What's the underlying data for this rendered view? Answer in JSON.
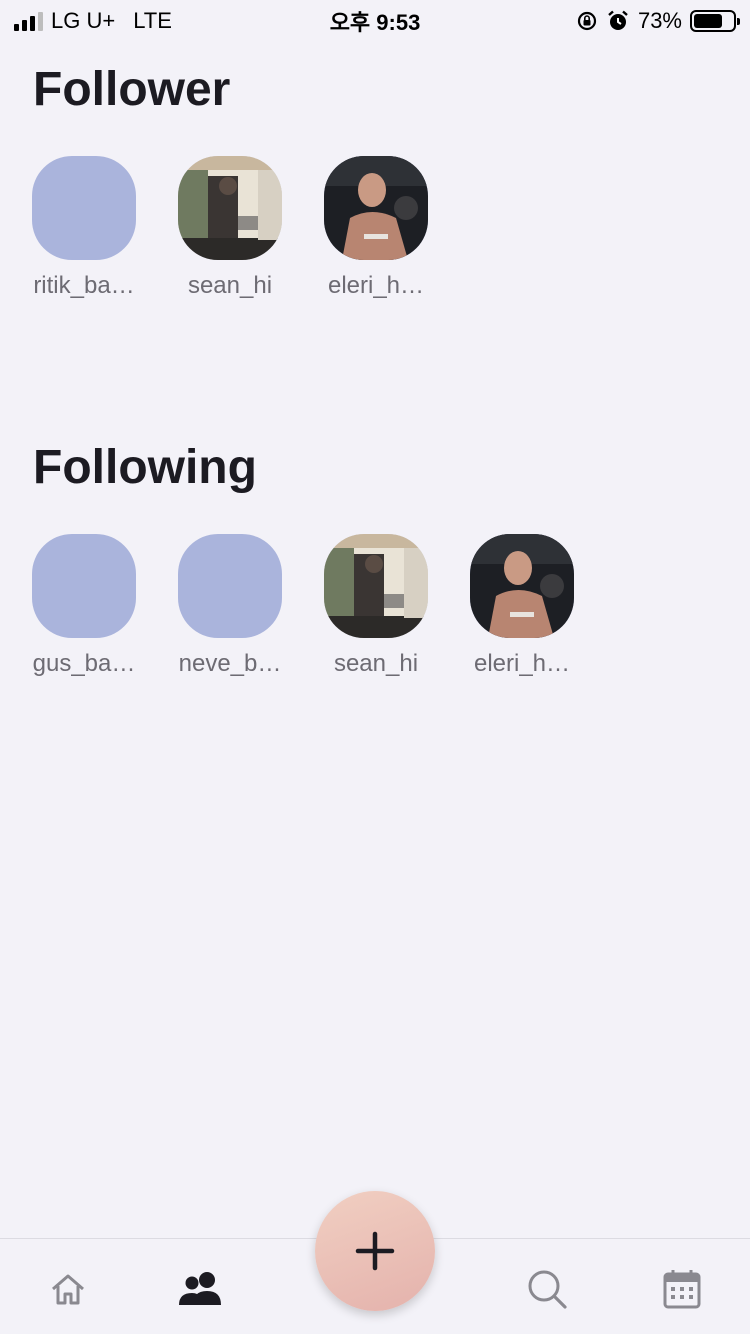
{
  "status_bar": {
    "carrier": "LG U+",
    "network": "LTE",
    "time": "오후 9:53",
    "battery": "73%",
    "battery_level": 0.73
  },
  "follower": {
    "title": "Follower",
    "users": [
      {
        "name": "ritik_ba…",
        "avatar": "placeholder"
      },
      {
        "name": "sean_hi",
        "avatar": "photo-mirror-selfie"
      },
      {
        "name": "eleri_h…",
        "avatar": "photo-tv-scene"
      }
    ]
  },
  "following": {
    "title": "Following",
    "users": [
      {
        "name": "gus_ba…",
        "avatar": "placeholder"
      },
      {
        "name": "neve_b…",
        "avatar": "placeholder"
      },
      {
        "name": "sean_hi",
        "avatar": "photo-mirror-selfie"
      },
      {
        "name": "eleri_h…",
        "avatar": "photo-tv-scene"
      }
    ]
  },
  "nav": {
    "items": [
      "home-icon",
      "people-icon",
      "search-icon",
      "calendar-icon"
    ],
    "active": "people-icon",
    "fab_icon": "plus-icon"
  },
  "colors": {
    "background": "#f3f2f8",
    "avatar_placeholder": "#aab4dc",
    "fab_gradient_start": "#f1cfc2",
    "fab_gradient_end": "#e4b2ac"
  }
}
